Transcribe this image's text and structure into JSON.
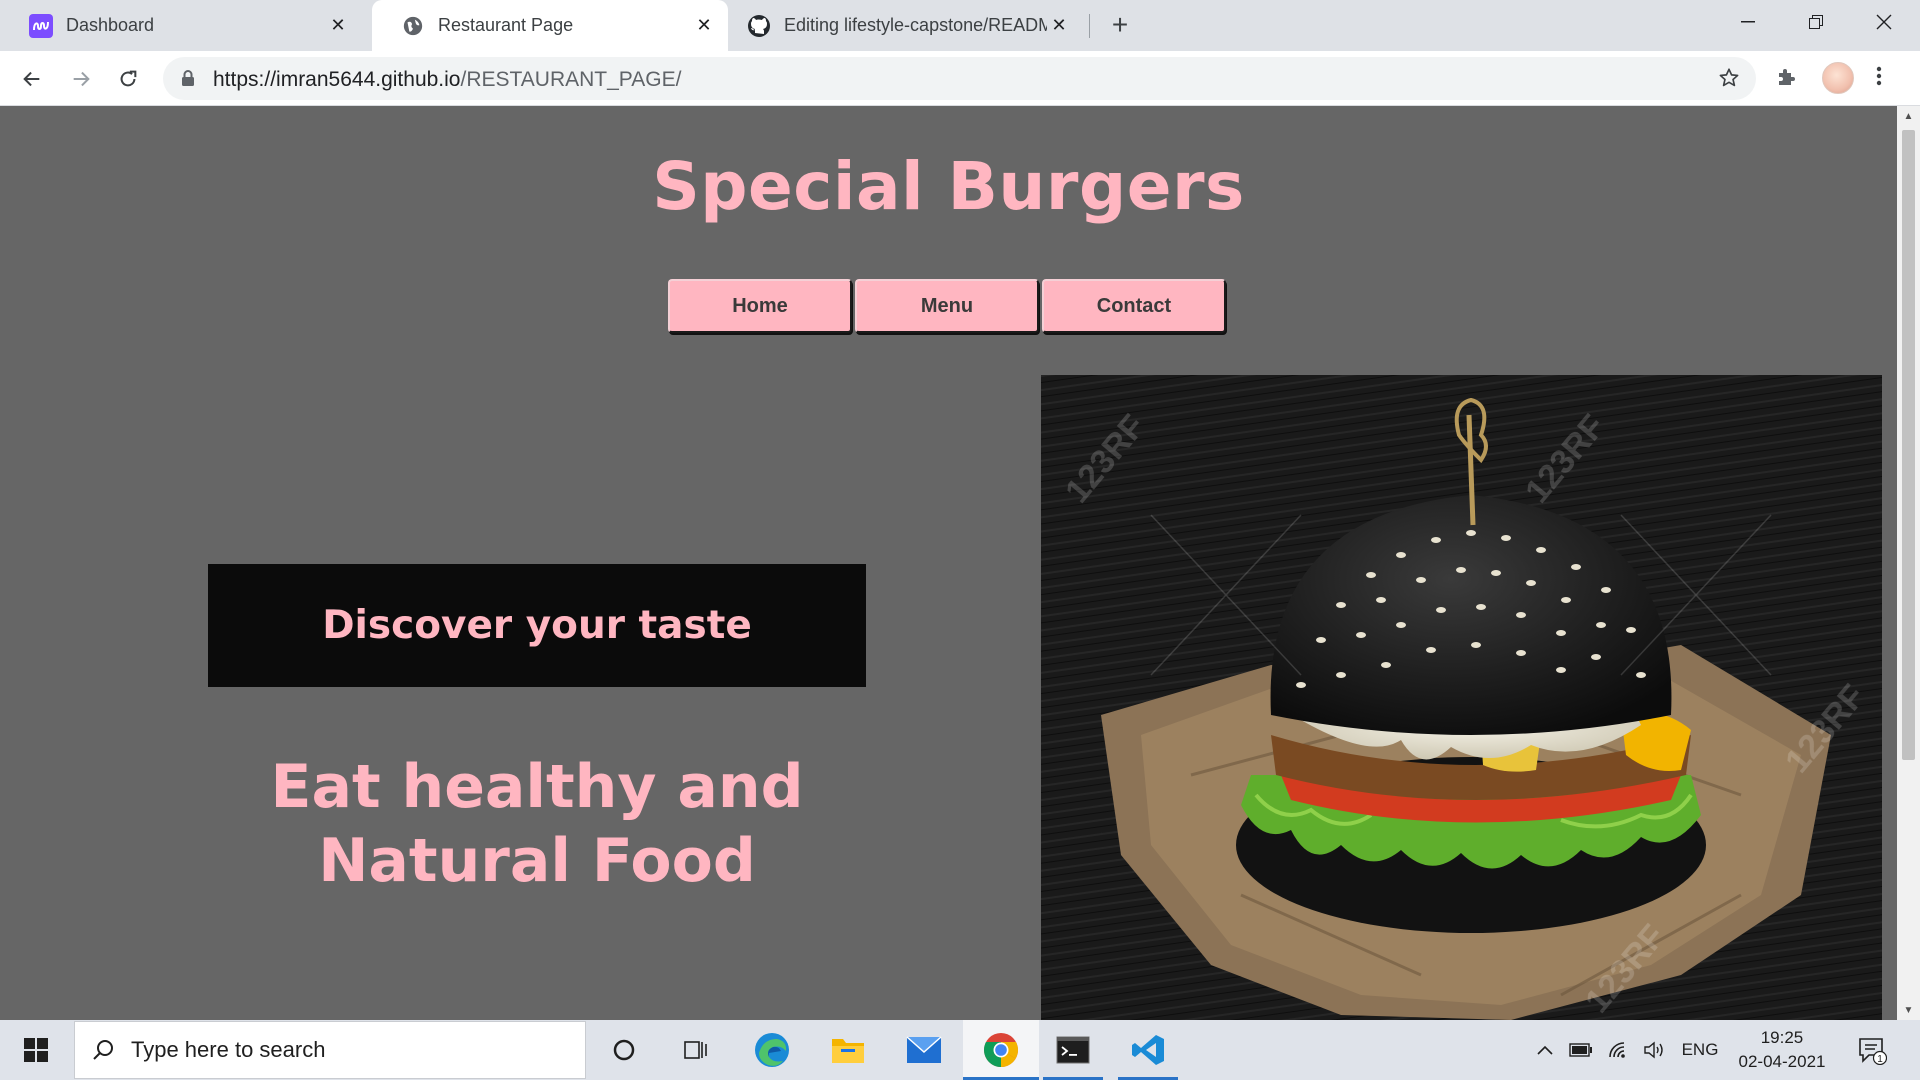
{
  "browser": {
    "tabs": [
      {
        "title": "Dashboard",
        "icon": "dashboard-app-icon"
      },
      {
        "title": "Restaurant Page",
        "icon": "globe-icon",
        "active": true
      },
      {
        "title": "Editing lifestyle-capstone/README",
        "icon": "github-icon"
      }
    ],
    "url_host": "https://imran5644.github.io",
    "url_path": "/RESTAURANT_PAGE/"
  },
  "page": {
    "title": "Special Burgers",
    "nav": [
      "Home",
      "Menu",
      "Contact"
    ],
    "tagline": "Discover your taste",
    "headline_line1": "Eat healthy and",
    "headline_line2": "Natural Food",
    "hero_watermark": "123RF",
    "colors": {
      "accent": "#ffb6c1",
      "background": "#666666",
      "box": "#0b0b0b"
    }
  },
  "taskbar": {
    "search_placeholder": "Type here to search",
    "language": "ENG",
    "time": "19:25",
    "date": "02-04-2021",
    "notification_count": "1"
  }
}
